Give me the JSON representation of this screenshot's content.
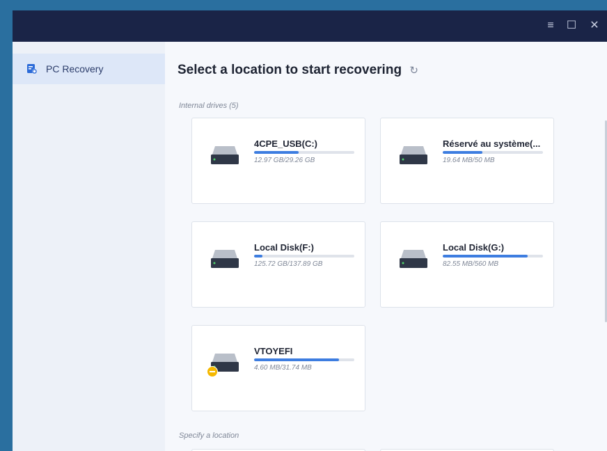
{
  "window": {
    "controls": {
      "menu": "≡",
      "maximize": "☐",
      "close": "✕"
    }
  },
  "sidebar": {
    "items": [
      {
        "label": "PC Recovery",
        "icon": "pc-recovery-icon",
        "active": true
      }
    ]
  },
  "main": {
    "title": "Select a location to start recovering",
    "refresh_icon": "↻",
    "internal_drives_label": "Internal drives (5)",
    "specify_location_label": "Specify a location",
    "drives": [
      {
        "name": "4CPE_USB(C:)",
        "size": "12.97 GB/29.26 GB",
        "used_fraction": 0.443,
        "warning": false
      },
      {
        "name": "Réservé au système(...",
        "size": "19.64 MB/50 MB",
        "used_fraction": 0.393,
        "warning": false
      },
      {
        "name": "Local Disk(F:)",
        "size": "125.72 GB/137.89 GB",
        "used_fraction": 0.08,
        "warning": false
      },
      {
        "name": "Local Disk(G:)",
        "size": "82.55 MB/560 MB",
        "used_fraction": 0.85,
        "warning": false
      },
      {
        "name": "VTOYEFI",
        "size": "4.60 MB/31.74 MB",
        "used_fraction": 0.85,
        "warning": true
      }
    ]
  },
  "colors": {
    "titlebar": "#1a2447",
    "accent": "#3d7de0",
    "sidebar_active": "#dde7f8",
    "warning": "#f5b800"
  }
}
